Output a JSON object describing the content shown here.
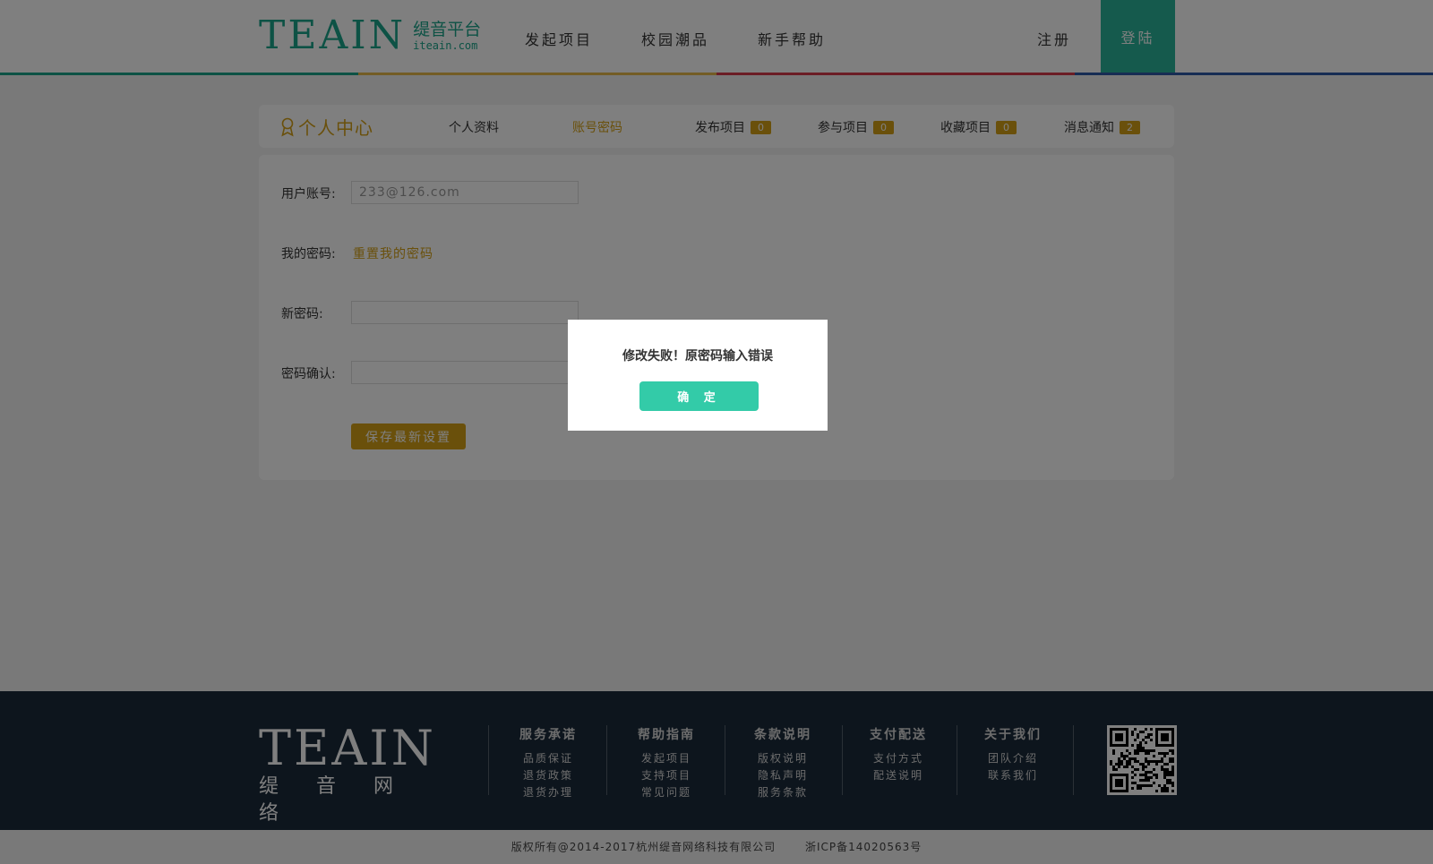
{
  "header": {
    "logo_text": "TEAIN",
    "logo_cn": "缇音平台",
    "logo_domain": "iteain.com",
    "nav": [
      "发起项目",
      "校园潮品",
      "新手帮助"
    ],
    "register": "注册",
    "login": "登陆",
    "stripe_colors": [
      "#1aa58a",
      "#e7b84a",
      "#d63a4a",
      "#2e5aa8"
    ]
  },
  "center": {
    "title": "个人中心",
    "tabs": [
      {
        "label": "个人资料"
      },
      {
        "label": "账号密码",
        "active": true
      },
      {
        "label": "发布项目",
        "count": "0"
      },
      {
        "label": "参与项目",
        "count": "0"
      },
      {
        "label": "收藏项目",
        "count": "0"
      },
      {
        "label": "消息通知",
        "count": "2"
      }
    ]
  },
  "form": {
    "account_label": "用户账号:",
    "account_placeholder": "233@126.com",
    "password_label": "我的密码:",
    "reset_link": "重置我的密码",
    "new_password_label": "新密码:",
    "confirm_label": "密码确认:",
    "save_button": "保存最新设置"
  },
  "dialog": {
    "message": "修改失败！原密码输入错误",
    "ok_button": "确 定"
  },
  "footer": {
    "logo_text": "TEAIN",
    "logo_cn": "缇音网络",
    "columns": [
      {
        "heading": "服务承诺",
        "items": [
          "品质保证",
          "退货政策",
          "退货办理"
        ]
      },
      {
        "heading": "帮助指南",
        "items": [
          "发起项目",
          "支持项目",
          "常见问题"
        ]
      },
      {
        "heading": "条款说明",
        "items": [
          "版权说明",
          "隐私声明",
          "服务条款"
        ]
      },
      {
        "heading": "支付配送",
        "items": [
          "支付方式",
          "配送说明"
        ]
      },
      {
        "heading": "关于我们",
        "items": [
          "团队介绍",
          "联系我们"
        ]
      }
    ],
    "copyright": "版权所有@2014-2017杭州缇音网络科技有限公司",
    "icp": "浙ICP备14020563号"
  },
  "colors": {
    "brand_green": "#1aa58a",
    "accent_gold": "#d4a017",
    "dialog_button": "#33cba8",
    "footer_bg": "#1b2a3a"
  }
}
